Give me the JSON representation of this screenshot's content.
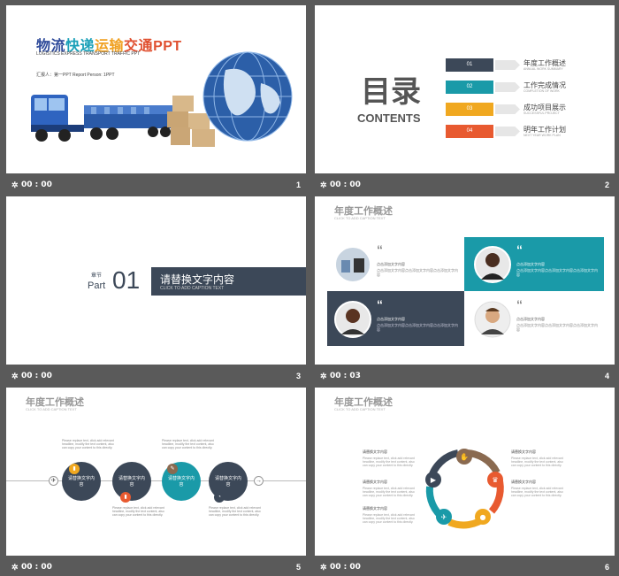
{
  "slides": [
    {
      "number": "1",
      "time": "00 : 00",
      "title_parts": [
        {
          "text": "物流",
          "color": "#2e4a9a"
        },
        {
          "text": "快递",
          "color": "#1aa0b8"
        },
        {
          "text": "运输",
          "color": "#f0a020"
        },
        {
          "text": "交通",
          "color": "#e05030"
        },
        {
          "text": "PPT",
          "color": "#e05030"
        }
      ],
      "subtitle": "LOGISTICS EXPRESS TRANSPORT TRAFFIC PPT",
      "reporter": "汇报人：第一PPT    Report Person: 1PPT"
    },
    {
      "number": "2",
      "time": "00 : 00",
      "heading": "目录",
      "heading_en": "CONTENTS",
      "items": [
        {
          "num": "01",
          "label": "年度工作概述",
          "sub": "ANNUAL WORK SUMMARY",
          "color": "#3c4858"
        },
        {
          "num": "02",
          "label": "工作完成情况",
          "sub": "COMPLETION OF WORK",
          "color": "#1a9aa8"
        },
        {
          "num": "03",
          "label": "成功项目展示",
          "sub": "SUCCESSFUL PROJECT",
          "color": "#f0a820"
        },
        {
          "num": "04",
          "label": "明年工作计划",
          "sub": "NEXT YEAR WORK PLAN",
          "color": "#e85a30"
        }
      ]
    },
    {
      "number": "3",
      "time": "00 : 00",
      "chapter_label": "章节",
      "part_label": "Part",
      "part_number": "01",
      "banner_title": "请替换文字内容",
      "banner_sub": "CLICK TO ADD CAPTION TEXT"
    },
    {
      "number": "4",
      "time": "00 : 03",
      "title": "年度工作概述",
      "subtitle": "CLICK TO ADD CAPTION TEXT",
      "quote_title": "点击添加文字内容",
      "body": "点击添加文字内容点击添加文字内容点击添加文字内容"
    },
    {
      "number": "5",
      "time": "00 : 00",
      "title": "年度工作概述",
      "subtitle": "CLICK TO ADD CAPTION TEXT",
      "circle_label": "请替换文字内容",
      "note": "Please replace text, click add relevant headline, modify the text content, also can copy your content to this directly."
    },
    {
      "number": "6",
      "time": "00 : 00",
      "title": "年度工作概述",
      "subtitle": "CLICK TO ADD CAPTION TEXT",
      "item_label": "请替换文字内容",
      "note": "Please replace text, click add relevant headline, modify the text content, also can copy your content to this directly."
    }
  ]
}
